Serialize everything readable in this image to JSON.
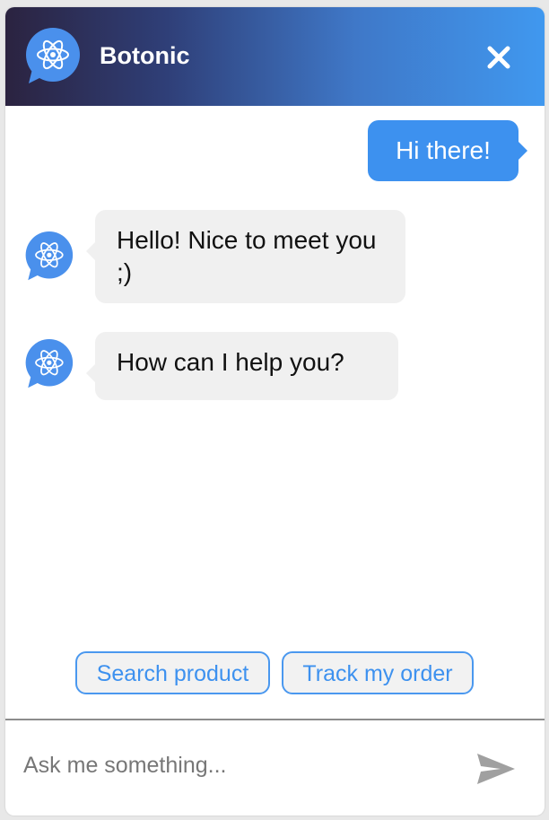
{
  "header": {
    "title": "Botonic",
    "avatar_icon": "atom-chat-icon",
    "close_icon": "close-icon",
    "gradient_start": "#2b2340",
    "gradient_end": "#4098ef"
  },
  "messages": [
    {
      "from": "user",
      "text": "Hi there!"
    },
    {
      "from": "bot",
      "text": "Hello! Nice to meet you ;)"
    },
    {
      "from": "bot",
      "text": "How can I help you?"
    }
  ],
  "quick_replies": [
    {
      "label": "Search product"
    },
    {
      "label": "Track my order"
    }
  ],
  "input": {
    "placeholder": "Ask me something...",
    "value": "",
    "send_icon": "send-icon"
  },
  "colors": {
    "accent": "#3d91ef",
    "bot_bubble": "#f0f0f0",
    "user_bubble": "#3d91ef"
  }
}
